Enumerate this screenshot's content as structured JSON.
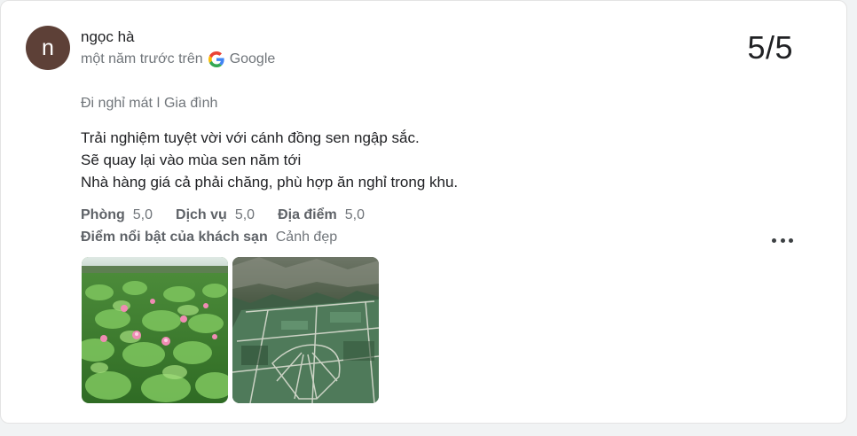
{
  "reviewer": {
    "avatar_letter": "n",
    "name": "ngọc hà",
    "time": "một năm trước trên",
    "source": "Google"
  },
  "score": "5/5",
  "trip_type": "Đi nghỉ mát ǀ Gia đình",
  "review_lines": [
    "Trải nghiệm tuyệt vời với cánh đồng sen ngập sắc.",
    "Sẽ quay lại vào mùa sen năm tới",
    "Nhà hàng giá cả phải chăng, phù hợp ăn nghỉ trong khu."
  ],
  "ratings": [
    {
      "label": "Phòng",
      "value": "5,0"
    },
    {
      "label": "Dịch vụ",
      "value": "5,0"
    },
    {
      "label": "Địa điểm",
      "value": "5,0"
    }
  ],
  "highlight": {
    "label": "Điểm nổi bật của khách sạn",
    "value": "Cảnh đẹp"
  },
  "photos": [
    "lotus-field-photo",
    "aerial-lotus-field-photo"
  ],
  "colors": {
    "avatar": "#5d4037",
    "muted_text": "#70757a"
  }
}
